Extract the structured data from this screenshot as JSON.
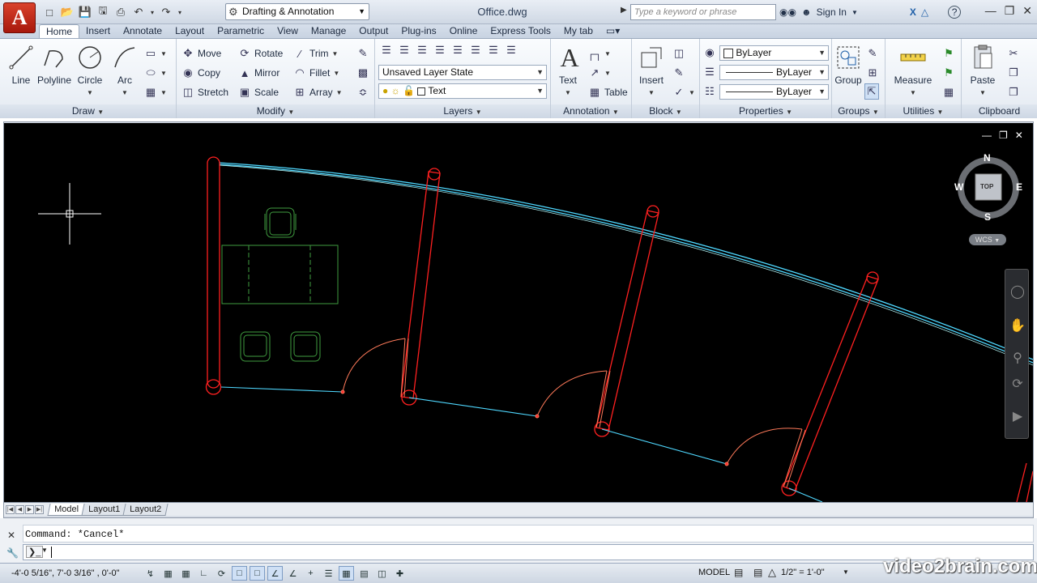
{
  "title_bar": {
    "app_logo": "A",
    "workspace": "Drafting & Annotation",
    "document_title": "Office.dwg",
    "search_placeholder": "Type a keyword or phrase",
    "sign_in": "Sign In"
  },
  "tabs": [
    "Home",
    "Insert",
    "Annotate",
    "Layout",
    "Parametric",
    "View",
    "Manage",
    "Output",
    "Plug-ins",
    "Online",
    "Express Tools",
    "My tab"
  ],
  "active_tab": "Home",
  "ribbon": {
    "draw": {
      "title": "Draw",
      "line": "Line",
      "polyline": "Polyline",
      "circle": "Circle",
      "arc": "Arc"
    },
    "modify": {
      "title": "Modify",
      "move": "Move",
      "rotate": "Rotate",
      "trim": "Trim",
      "copy": "Copy",
      "mirror": "Mirror",
      "fillet": "Fillet",
      "stretch": "Stretch",
      "scale": "Scale",
      "array": "Array"
    },
    "layers": {
      "title": "Layers",
      "layer_state": "Unsaved Layer State",
      "current_layer": "Text"
    },
    "annotation": {
      "title": "Annotation",
      "text": "Text",
      "table": "Table"
    },
    "block": {
      "title": "Block",
      "insert": "Insert"
    },
    "properties": {
      "title": "Properties",
      "color": "ByLayer",
      "linetype": "ByLayer",
      "lineweight": "ByLayer"
    },
    "groups": {
      "title": "Groups",
      "group": "Group"
    },
    "utilities": {
      "title": "Utilities",
      "measure": "Measure"
    },
    "clipboard": {
      "title": "Clipboard",
      "paste": "Paste"
    }
  },
  "viewcube": {
    "north": "N",
    "south": "S",
    "east": "E",
    "west": "W",
    "face": "TOP",
    "ucs": "WCS"
  },
  "layout_tabs": [
    "Model",
    "Layout1",
    "Layout2"
  ],
  "active_layout": "Model",
  "command_line": {
    "history": "Command:  *Cancel*",
    "input": ""
  },
  "status_bar": {
    "coordinates": "-4'-0 5/16\", 7'-0 3/16\" , 0'-0\"",
    "space": "MODEL",
    "annotation_scale": "1/2\" = 1'-0\""
  },
  "watermark": "video2brain.com",
  "colors": {
    "wall": "#ff2020",
    "glass": "#4fd8ff",
    "furniture": "#3f9b3f",
    "door": "#ff3030",
    "viewport_bg": "#000000",
    "accent": "#3a6ea5"
  }
}
